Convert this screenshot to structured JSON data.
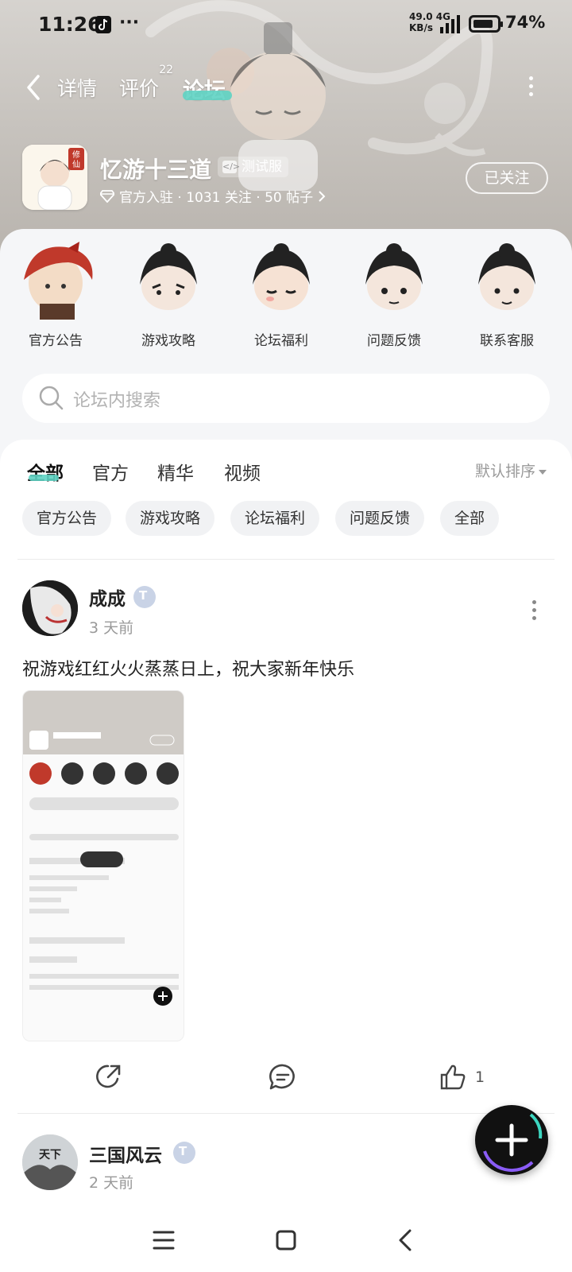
{
  "status_bar": {
    "time": "11:26",
    "notif_more": "···",
    "net_speed_value": "49.0",
    "net_speed_unit": "KB/s",
    "net_type": "4G",
    "battery_pct": "74%"
  },
  "top_nav": {
    "tabs": [
      {
        "label": "详情",
        "active": false
      },
      {
        "label": "评价",
        "badge": "22",
        "active": false
      },
      {
        "label": "论坛",
        "active": true
      }
    ]
  },
  "game": {
    "title": "忆游十三道",
    "test_tag": "测试服",
    "icon_text": "修仙",
    "meta": "官方入驻 · 1031 关注 · 50 帖子",
    "follow_label": "已关注"
  },
  "categories": [
    {
      "label": "官方公告",
      "icon": "official-announcement-icon"
    },
    {
      "label": "游戏攻略",
      "icon": "game-guide-icon"
    },
    {
      "label": "论坛福利",
      "icon": "forum-welfare-icon"
    },
    {
      "label": "问题反馈",
      "icon": "feedback-icon"
    },
    {
      "label": "联系客服",
      "icon": "customer-service-icon"
    }
  ],
  "search": {
    "placeholder": "论坛内搜索"
  },
  "feed_tabs": [
    {
      "label": "全部",
      "active": true
    },
    {
      "label": "官方",
      "active": false
    },
    {
      "label": "精华",
      "active": false
    },
    {
      "label": "视频",
      "active": false
    }
  ],
  "sort_label": "默认排序",
  "chips": [
    "官方公告",
    "游戏攻略",
    "论坛福利",
    "问题反馈",
    "全部"
  ],
  "posts": [
    {
      "author": "成成",
      "time": "3 天前",
      "text": "祝游戏红红火火蒸蒸日上，祝大家新年快乐",
      "likes": "1"
    },
    {
      "author": "三国风云",
      "avatar_text": "天下",
      "time": "2 天前"
    }
  ],
  "colors": {
    "accent": "#5ed3c3",
    "text_primary": "#222222",
    "text_muted": "#999999",
    "chip_bg": "#f1f2f4"
  }
}
